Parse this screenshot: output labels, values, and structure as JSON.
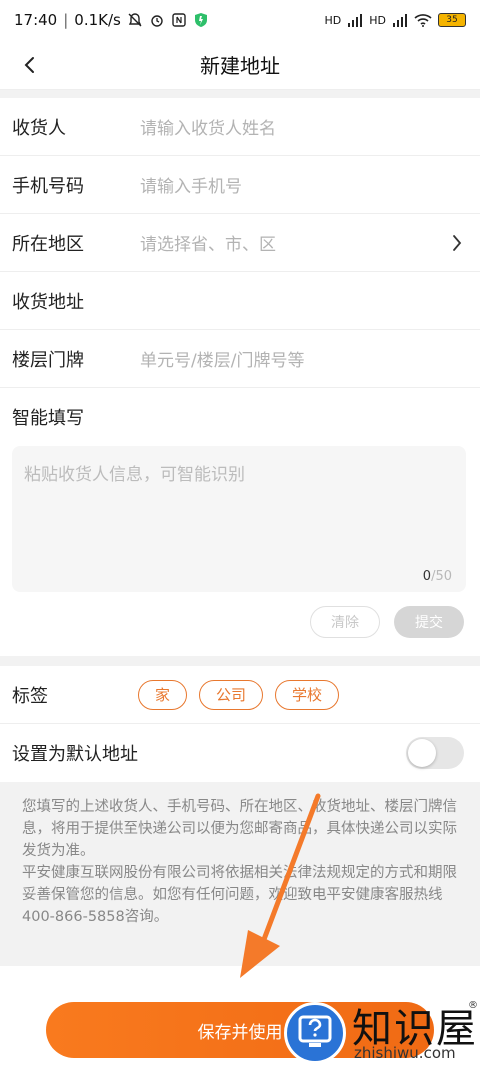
{
  "status_bar": {
    "time": "17:40",
    "speed": "0.1K/s",
    "battery": "35",
    "signal1": "HD",
    "signal2": "HD"
  },
  "nav": {
    "title": "新建地址"
  },
  "form": {
    "fields": [
      {
        "label": "收货人",
        "placeholder": "请输入收货人姓名"
      },
      {
        "label": "手机号码",
        "placeholder": "请输入手机号"
      },
      {
        "label": "所在地区",
        "placeholder": "请选择省、市、区"
      },
      {
        "label": "收货地址",
        "placeholder": ""
      },
      {
        "label": "楼层门牌",
        "placeholder": "单元号/楼层/门牌号等"
      }
    ],
    "smart_fill": {
      "title": "智能填写",
      "placeholder": "粘贴收货人信息，可智能识别",
      "count_current": "0",
      "count_max": "/50",
      "clear_label": "清除",
      "submit_label": "提交"
    },
    "tags": {
      "label": "标签",
      "items": [
        "家",
        "公司",
        "学校"
      ]
    },
    "default_address": {
      "label": "设置为默认地址",
      "enabled": false
    }
  },
  "notice": {
    "paragraph1": "您填写的上述收货人、手机号码、所在地区、收货地址、楼层门牌信息，将用于提供至快递公司以便为您邮寄商品，具体快递公司以实际发货为准。",
    "paragraph2": "平安健康互联网股份有限公司将依据相关法律法规规定的方式和期限妥善保管您的信息。如您有任何问题，欢迎致电平安健康客服热线400-866-5858咨询。"
  },
  "footer": {
    "save_label": "保存并使用"
  },
  "watermark": {
    "title": "知识屋",
    "subtitle": "zhishiwu.com",
    "mark": "®"
  },
  "colors": {
    "accent": "#f97a1e",
    "tag_border": "#e8782f",
    "placeholder": "#b3b3b3",
    "annotation_arrow": "#f47a2a"
  }
}
